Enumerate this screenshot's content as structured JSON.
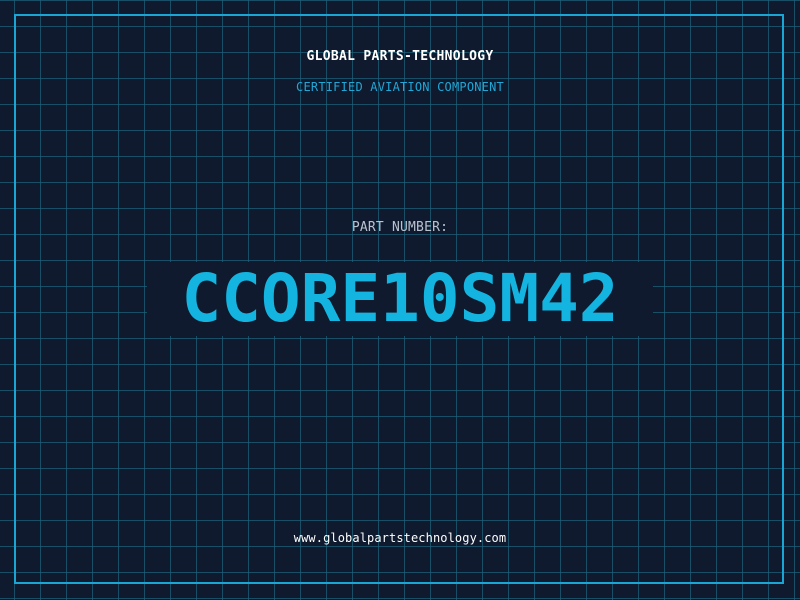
{
  "label": {
    "company": "GLOBAL PARTS-TECHNOLOGY",
    "subtitle": "CERTIFIED AVIATION COMPONENT",
    "part_label": "PART NUMBER:",
    "part_number": "CCORE10SM42",
    "website": "www.globalpartstechnology.com"
  },
  "colors": {
    "background": "#101a2e",
    "grid": "#1c6078",
    "frame": "#1aa6d4",
    "accent": "#14b4e0",
    "subtitle": "#1fa7d6",
    "text": "#ffffff",
    "muted_text": "#b9c3cf"
  }
}
